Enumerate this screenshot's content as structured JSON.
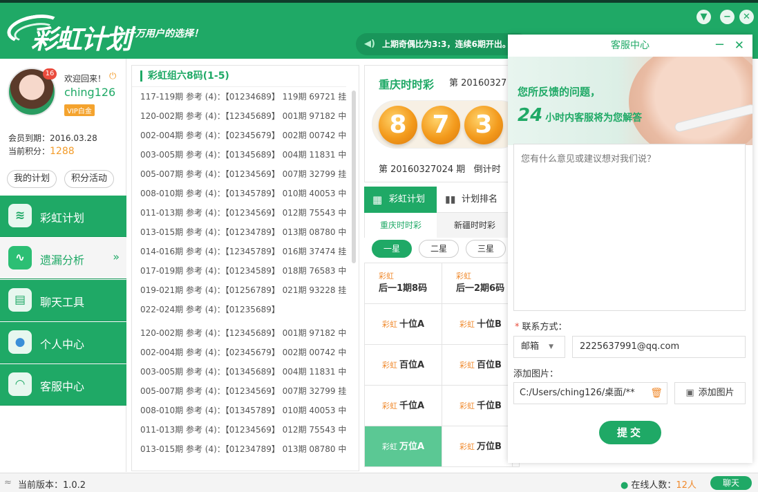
{
  "header": {
    "brand": "彩虹计划",
    "slogan": "千万用户的选择！",
    "notice": "上期奇偶比为3:3，连续6期开出。",
    "skin_icon": "shirt-icon",
    "minimize_icon": "minus-icon",
    "close_icon": "close-icon"
  },
  "user": {
    "badge": "16",
    "welcome": "欢迎回来！",
    "username": "ching126",
    "vip": "VIP白金",
    "expire_label": "会员到期：",
    "expire": "2016.03.28",
    "points_label": "当前积分：",
    "points": "1288",
    "my_plan": "我的计划",
    "points_activity": "积分活动"
  },
  "nav": [
    {
      "label": "彩虹计划",
      "icon": "rainbow-icon"
    },
    {
      "label": "遗漏分析",
      "icon": "chart-line-icon"
    },
    {
      "label": "聊天工具",
      "icon": "chat-icon"
    },
    {
      "label": "个人中心",
      "icon": "user-icon"
    },
    {
      "label": "客服中心",
      "icon": "headset-icon"
    }
  ],
  "list": {
    "title": "彩虹组六8码(1-5)",
    "rows": [
      "117-119期 参考 (4)：【01234689】 119期 69721 挂",
      "120-002期 参考 (4)：【12345689】 001期 97182 中",
      "002-004期 参考 (4)：【02345679】 002期 00742 中",
      "003-005期 参考 (4)：【01345689】 004期 11831 中",
      "005-007期 参考 (4)：【01234569】 007期 32799 挂",
      "008-010期 参考 (4)：【01345789】 010期 40053 中",
      "011-013期 参考 (4)：【01234569】 012期 75543 中",
      "013-015期 参考 (4)：【01234789】 013期 08780 中",
      "014-016期 参考 (4)：【12345789】 016期 37474 挂",
      "017-019期 参考 (4)：【01234589】 018期 76583 中",
      "019-021期 参考 (4)：【01256789】 021期 93228 挂",
      "022-024期 参考 (4)：【01235689】",
      "120-002期 参考 (4)：【12345689】 001期 97182 中",
      "002-004期 参考 (4)：【02345679】 002期 00742 中",
      "003-005期 参考 (4)：【01345689】 004期 11831 中",
      "005-007期 参考 (4)：【01234569】 007期 32799 挂",
      "008-010期 参考 (4)：【01345789】 010期 40053 中",
      "011-013期 参考 (4)：【01234569】 012期 75543 中",
      "013-015期 参考 (4)：【01234789】 013期 08780 中"
    ]
  },
  "lottery": {
    "name": "重庆时时彩",
    "issue": "第 20160327",
    "balls": [
      "8",
      "7",
      "3"
    ],
    "footer_issue": "第 20160327024 期",
    "footer_countdown": "倒计时"
  },
  "tabs": {
    "plan": "彩虹计划",
    "rank": "计划排名",
    "sub_cq": "重庆时时彩",
    "sub_xj": "新疆时时彩",
    "stars": [
      "一星",
      "二星",
      "三星"
    ]
  },
  "grid": {
    "tag": "彩虹",
    "heads": [
      "后一1期8码",
      "后一2期6码"
    ],
    "cells": [
      "十位A",
      "十位B",
      "百位A",
      "百位B",
      "千位A",
      "千位B",
      "万位A",
      "万位B"
    ]
  },
  "service": {
    "title": "客服中心",
    "line1": "您所反馈的问题，",
    "line2_num": "24",
    "line2_text": "小时内客服将为您解答",
    "placeholder": "您有什么意见或建议想对我们说？",
    "contact_label": "联系方式：",
    "contact_type": "邮箱",
    "contact_value": "2225637991@qq.com",
    "image_label": "添加图片：",
    "image_path": "C:/Users/ching126/桌面/**",
    "add_image": "添加图片",
    "submit": "提交"
  },
  "footer": {
    "version": "当前版本：1.0.2",
    "online_label": "在线人数：",
    "online_count": "12人",
    "chat": "聊天"
  },
  "colors": {
    "brand_green": "#1fa966",
    "accent_orange": "#f39a1c"
  }
}
